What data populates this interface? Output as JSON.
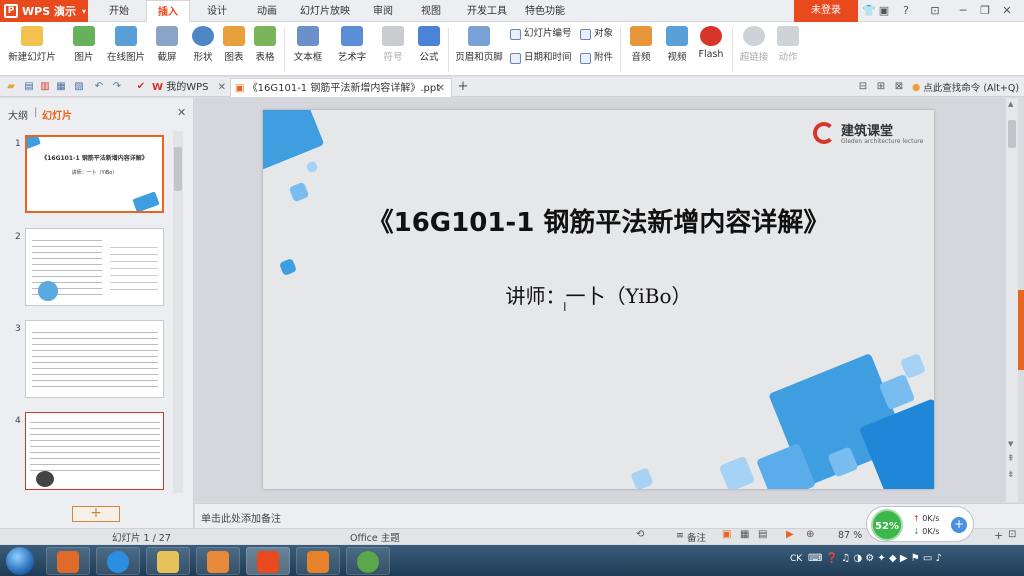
{
  "app": {
    "name": "WPS 演示",
    "logo": "P"
  },
  "menu_tabs": [
    "开始",
    "插入",
    "设计",
    "动画",
    "幻灯片放映",
    "审阅",
    "视图",
    "开发工具",
    "特色功能"
  ],
  "active_menu": "插入",
  "login": "未登录",
  "ribbon": {
    "new_slide": "新建幻灯片",
    "picture": "图片",
    "online_picture": "在线图片",
    "screenshot": "截屏",
    "shape": "形状",
    "chart": "图表",
    "table": "表格",
    "textbox": "文本框",
    "art_text": "艺术字",
    "symbol": "符号",
    "formula": "公式",
    "header_footer": "页眉和页脚",
    "slide_number": "幻灯片编号",
    "object": "对象",
    "date_time": "日期和时间",
    "attachment": "附件",
    "audio": "音频",
    "video": "视频",
    "flash": "Flash",
    "hyperlink": "超链接",
    "action": "动作"
  },
  "tabs": {
    "my_wps": "我的WPS",
    "document": "《16G101-1 钢筋平法新增内容详解》.ppt",
    "search": "点此查找命令 (Alt+Q)"
  },
  "left_panel": {
    "outline": "大纲",
    "slides": "幻灯片",
    "thumb1_title": "《16G101-1 钢筋平法新增内容详解》",
    "thumb1_sub": "讲师：一卜（YiBo）"
  },
  "thumb_numbers": [
    "1",
    "2",
    "3",
    "4"
  ],
  "slide": {
    "title": "《16G101-1 钢筋平法新增内容详解》",
    "subtitle": "讲师：一卜（YiBo）",
    "brand_name": "建筑课堂",
    "brand_sub": "Gleden architecture lecture"
  },
  "notes_placeholder": "单击此处添加备注",
  "status": {
    "slide_info": "幻灯片 1 / 27",
    "theme": "Office 主题",
    "notes": "备注",
    "zoom": "87 %"
  },
  "speed_widget": {
    "percent": "52%",
    "up": "0K/s",
    "down": "0K/s"
  },
  "tray": {
    "lang": "CK",
    "time": ""
  },
  "colors": {
    "accent": "#e8491d",
    "slide_blue": "#3f9ee0",
    "selected_thumb": "#e8651e"
  }
}
